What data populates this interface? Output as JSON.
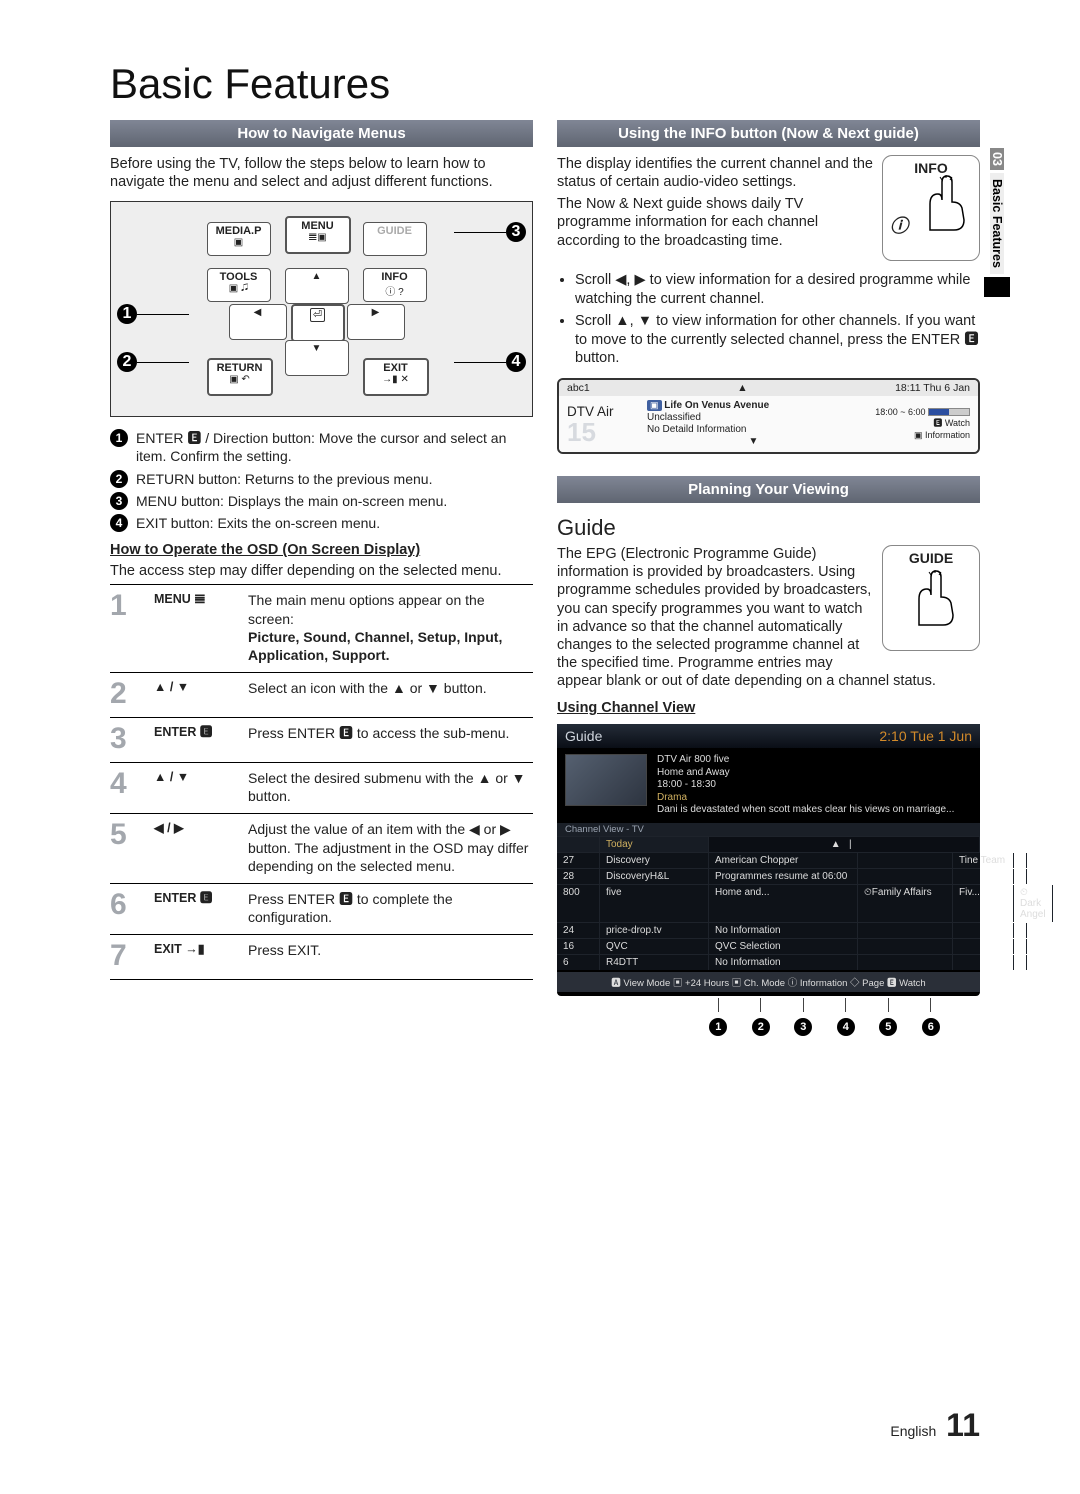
{
  "page_title": "Basic Features",
  "side_tab": {
    "num": "03",
    "text": "Basic Features"
  },
  "left": {
    "section_title": "How to Navigate Menus",
    "intro": "Before using the TV, follow the steps below to learn how to navigate the menu and select and adjust different functions.",
    "remote": {
      "mediap": "MEDIA.P",
      "menu": "MENU",
      "tools": "TOOLS",
      "info": "INFO",
      "return": "RETURN",
      "exit": "EXIT",
      "guide": "GUIDE"
    },
    "remote_callouts": [
      "1",
      "2",
      "3",
      "4"
    ],
    "numlist": [
      "ENTER 🅴 / Direction button: Move the cursor and select an item. Confirm the setting.",
      "RETURN button: Returns to the previous menu.",
      "MENU button: Displays the main on-screen menu.",
      "EXIT button: Exits the on-screen menu."
    ],
    "osd_title": "How to Operate the OSD (On Screen Display)",
    "osd_sub": "The access step may differ depending on the selected menu.",
    "steps": [
      {
        "n": "1",
        "key": "MENU 𝌆",
        "desc": "The main menu options appear on the screen:",
        "bold_line": "Picture, Sound, Channel, Setup, Input, Application, Support."
      },
      {
        "n": "2",
        "key": "▲ / ▼",
        "desc": "Select an icon with the ▲ or ▼ button."
      },
      {
        "n": "3",
        "key": "ENTER 🅴",
        "desc": "Press ENTER 🅴 to access the sub-menu."
      },
      {
        "n": "4",
        "key": "▲ / ▼",
        "desc": "Select the desired submenu with the ▲ or ▼ button."
      },
      {
        "n": "5",
        "key": "◀ / ▶",
        "desc": "Adjust the value of an item with the ◀ or ▶ button. The adjustment in the OSD may differ depending on the selected menu."
      },
      {
        "n": "6",
        "key": "ENTER 🅴",
        "desc": "Press ENTER 🅴 to complete the configuration."
      },
      {
        "n": "7",
        "key": "EXIT →▮",
        "desc": "Press EXIT."
      }
    ]
  },
  "right": {
    "info_section_title": "Using the INFO button (Now & Next guide)",
    "info_btn_label": "INFO",
    "info_para1": "The display identifies the current channel and the status of certain audio-video settings.",
    "info_para2": "The Now & Next guide shows daily TV programme information for each channel according to the broadcasting time.",
    "info_bullets": [
      "Scroll ◀, ▶ to view information for a desired programme while watching the current channel.",
      "Scroll ▲, ▼ to view information for other channels. If you want to move to the currently selected channel, press the ENTER 🅴 button."
    ],
    "nn": {
      "top_left": "abc1",
      "top_right": "18:11 Thu 6 Jan",
      "ch_label": "DTV Air",
      "ch_num": "15",
      "prog": "Life On Venus Avenue",
      "line2": "Unclassified",
      "line3": "No Detaild Information",
      "time": "18:00 ~ 6:00",
      "watch": "Watch",
      "information": "Information"
    },
    "plan_section_title": "Planning Your Viewing",
    "guide_heading": "Guide",
    "guide_btn_label": "GUIDE",
    "guide_para": "The EPG (Electronic Programme Guide) information is provided by broadcasters. Using programme schedules provided by broadcasters, you can specify programmes you want to watch in advance so that the channel automatically changes to the selected programme channel at the specified time. Programme entries may appear blank or out of date depending on a channel status.",
    "using_cv": "Using  Channel View",
    "gs": {
      "head_left": "Guide",
      "head_right": "2:10 Tue 1 Jun",
      "feat_line1": "DTV Air 800 five",
      "feat_line2": "Home and Away",
      "feat_line3": "18:00 - 18:30",
      "feat_line4": "Drama",
      "feat_line5": "Dani is devastated when scott makes clear his views on marriage...",
      "subhdr": "Channel View - TV",
      "today": "Today",
      "rows": [
        {
          "num": "27",
          "name": "Discovery",
          "c3": "American Chopper",
          "c4": "",
          "c5": "Tine Team",
          "rest": ""
        },
        {
          "num": "28",
          "name": "DiscoveryH&L",
          "c3": "Programmes resume at 06:00",
          "c4": "",
          "c5": "",
          "rest": ""
        },
        {
          "num": "800",
          "name": "five",
          "c3": "Home and...",
          "c4": "⏲Family Affairs",
          "c5": "Fiv...",
          "rest": "⏲Dark Angel"
        },
        {
          "num": "24",
          "name": "price-drop.tv",
          "c3": "No Information",
          "c4": "",
          "c5": "",
          "rest": ""
        },
        {
          "num": "16",
          "name": "QVC",
          "c3": "QVC Selection",
          "c4": "",
          "c5": "",
          "rest": ""
        },
        {
          "num": "6",
          "name": "R4DTT",
          "c3": "No Information",
          "c4": "",
          "c5": "",
          "rest": ""
        }
      ],
      "bottom": "🅰 View Mode  ▣ +24 Hours  ▣ Ch. Mode  ⓘ Information  ◇ Page  🅴 Watch",
      "dots": [
        "1",
        "2",
        "3",
        "4",
        "5",
        "6"
      ]
    }
  },
  "footer": {
    "lang": "English",
    "page": "11"
  }
}
